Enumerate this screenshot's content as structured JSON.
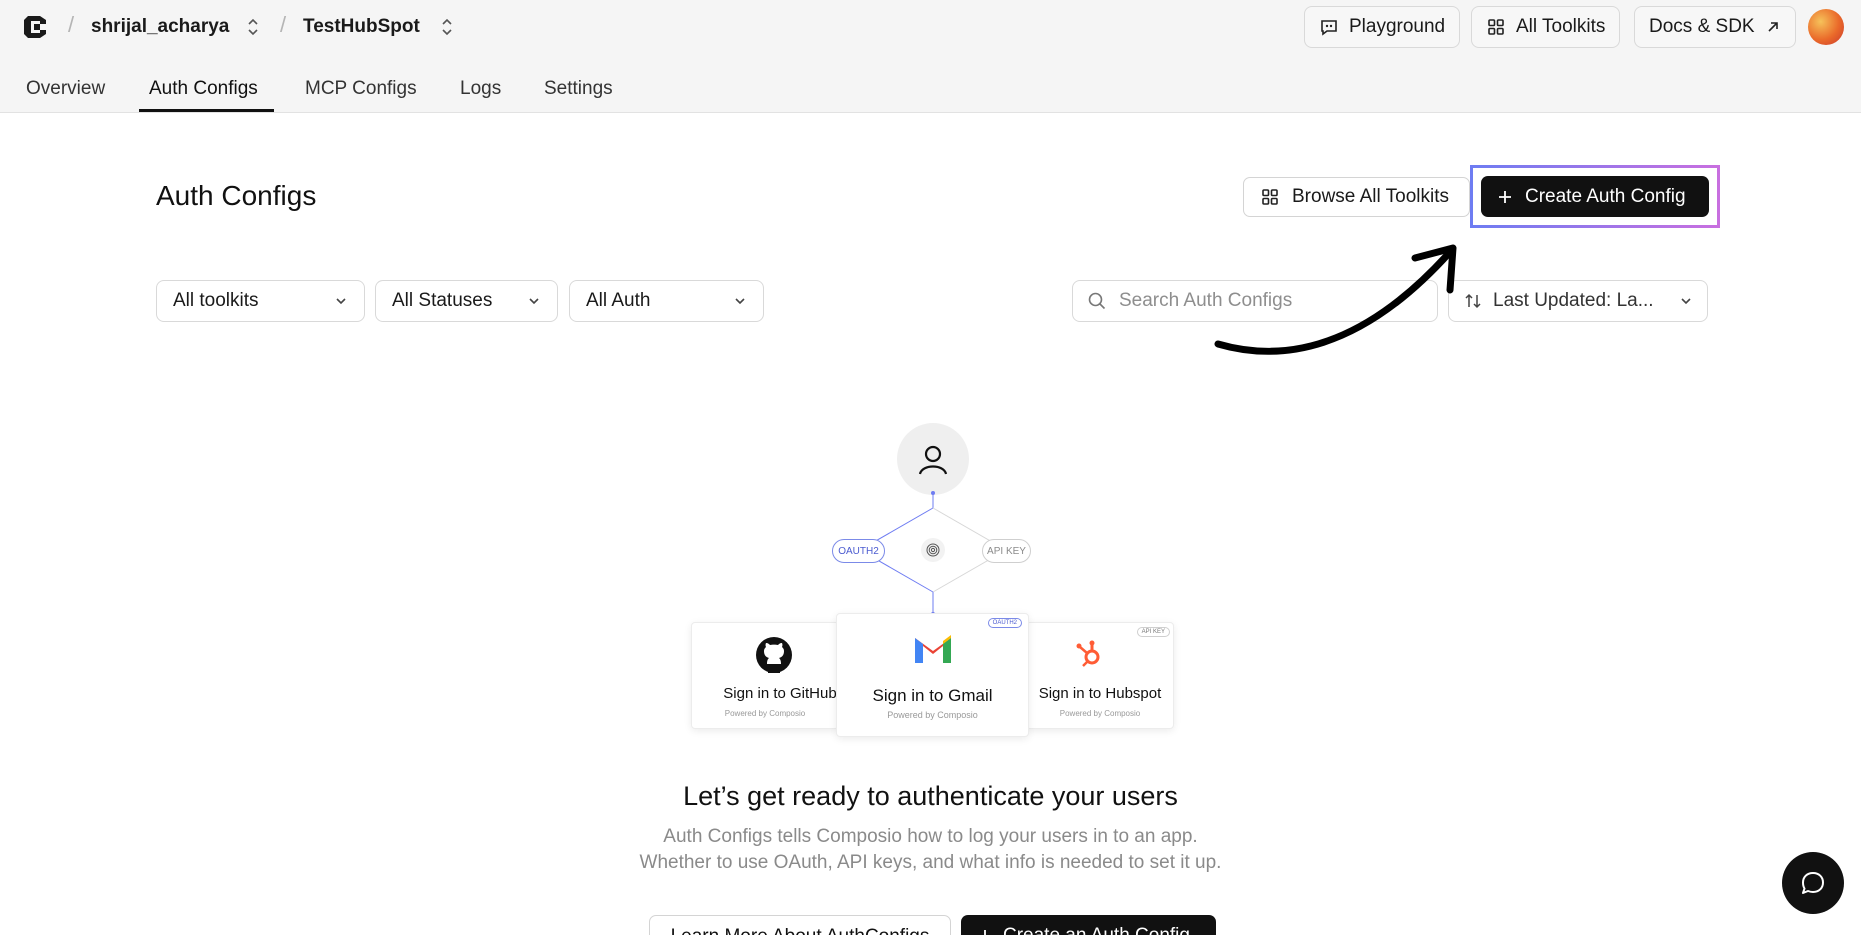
{
  "breadcrumb": {
    "org": "shrijal_acharya",
    "project": "TestHubSpot"
  },
  "header_buttons": {
    "playground": "Playground",
    "all_toolkits": "All Toolkits",
    "docs": "Docs & SDK"
  },
  "tabs": [
    {
      "label": "Overview"
    },
    {
      "label": "Auth Configs",
      "active": true
    },
    {
      "label": "MCP Configs"
    },
    {
      "label": "Logs"
    },
    {
      "label": "Settings"
    }
  ],
  "page": {
    "title": "Auth Configs",
    "browse_label": "Browse All Toolkits",
    "create_label": "Create Auth Config"
  },
  "filters": {
    "toolkits": "All toolkits",
    "statuses": "All Statuses",
    "auth": "All Auth",
    "search_placeholder": "Search Auth Configs",
    "sort": "Last Updated: La..."
  },
  "illustration": {
    "oauth_pill": "OAUTH2",
    "api_pill": "API KEY",
    "cards": {
      "github": {
        "label": "Sign in to GitHub",
        "powered": "Powered by Composio"
      },
      "gmail": {
        "label": "Sign in to Gmail",
        "powered": "Powered by Composio",
        "tag": "OAUTH2"
      },
      "hubspot": {
        "label": "Sign in to Hubspot",
        "powered": "Powered by Composio",
        "tag": "API KEY"
      }
    }
  },
  "empty_state": {
    "title": "Let’s get ready to authenticate your users",
    "line1": "Auth Configs tells Composio how to log your users in to an app.",
    "line2": "Whether to use OAuth, API keys, and what info is needed to set it up.",
    "learn_more": "Learn More About AuthConfigs",
    "create": "Create an Auth Config"
  },
  "colors": {
    "highlight_start": "#6e7cf2",
    "highlight_end": "#c86fe0",
    "hubspot": "#ff5c35"
  }
}
